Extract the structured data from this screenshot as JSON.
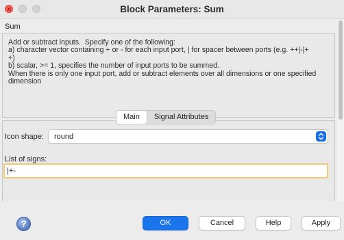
{
  "window": {
    "title": "Block Parameters: Sum"
  },
  "block": {
    "name": "Sum",
    "description": "Add or subtract inputs.  Specify one of the following:\na) character vector containing + or - for each input port, | for spacer between ports (e.g. ++|-|+\n+)\nb) scalar, >= 1, specifies the number of input ports to be summed.\nWhen there is only one input port, add or subtract elements over all dimensions or one specified\ndimension"
  },
  "tabs": [
    {
      "label": "Main",
      "active": true
    },
    {
      "label": "Signal Attributes",
      "active": false
    }
  ],
  "params": {
    "icon_shape_label": "Icon shape:",
    "icon_shape_value": "round",
    "list_of_signs_label": "List of signs:",
    "list_of_signs_value": "|+-"
  },
  "buttons": {
    "ok": "OK",
    "cancel": "Cancel",
    "help": "Help",
    "apply": "Apply"
  },
  "icons": {
    "help": "help-question-icon",
    "select": "updown-chevron-icon"
  },
  "colors": {
    "accent": "#1a74ec",
    "focus_ring": "#f3c971",
    "close": "#fe5f57"
  }
}
